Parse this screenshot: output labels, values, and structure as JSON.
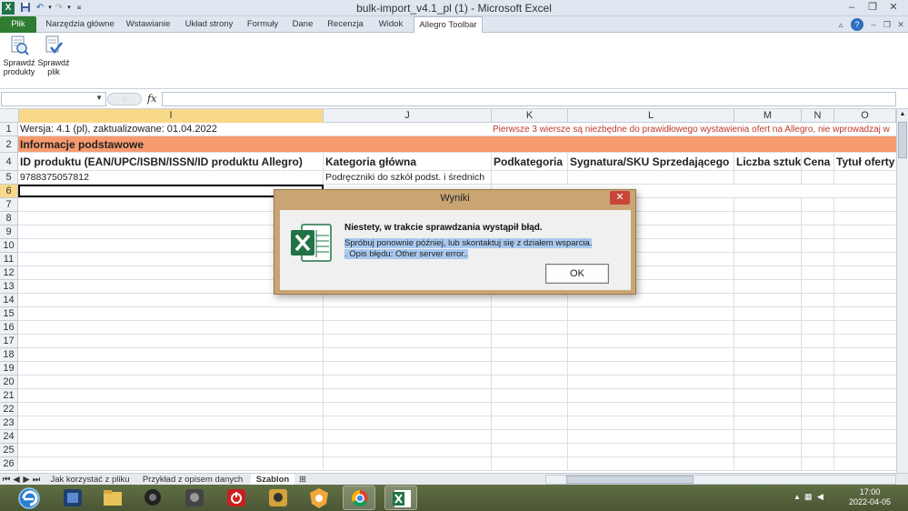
{
  "window": {
    "title": "bulk-import_v4.1_pl (1)  -  Microsoft Excel"
  },
  "ribbon_tabs": [
    {
      "label": "Plik"
    },
    {
      "label": "Narzędzia główne"
    },
    {
      "label": "Wstawianie"
    },
    {
      "label": "Układ strony"
    },
    {
      "label": "Formuły"
    },
    {
      "label": "Dane"
    },
    {
      "label": "Recenzja"
    },
    {
      "label": "Widok"
    },
    {
      "label": "Allegro Toolbar"
    }
  ],
  "ribbon": {
    "check_products_label": "Sprawdź produkty",
    "check_file_label": "Sprawdź plik"
  },
  "formula_bar": {
    "name_box_value": "",
    "fx_label": "fx",
    "formula_value": ""
  },
  "columns": [
    "I",
    "J",
    "K",
    "L",
    "M",
    "N",
    "O"
  ],
  "row_numbers": [
    "1",
    "2",
    "3",
    "4",
    "5",
    "6",
    "7",
    "8",
    "9",
    "10",
    "11",
    "12",
    "13",
    "14",
    "15",
    "16",
    "17",
    "18",
    "19",
    "20",
    "21",
    "22",
    "23",
    "24",
    "25",
    "26"
  ],
  "cells": {
    "r1_version": "Wersja: 4.1 (pl), zaktualizowane: 01.04.2022",
    "r1_note": "Pierwsze 3 wiersze są niezbędne do prawidłowego wystawienia ofert na Allegro, nie wprowadzaj w",
    "r2_section": "Informacje podstawowe",
    "r4_headers": [
      "ID produktu (EAN/UPC/ISBN/ISSN/ID produktu Allegro)",
      "Kategoria główna",
      "Podkategoria",
      "Sygnatura/SKU Sprzedającego",
      "Liczba sztuk",
      "Cena",
      "Tytuł oferty"
    ],
    "r5_values": [
      "9788375057812",
      "Podręczniki do szkół podst. i średnich"
    ]
  },
  "sheet_tabs": [
    {
      "label": "Jak korzystać z pliku"
    },
    {
      "label": "Przykład z opisem danych"
    },
    {
      "label": "Szablon"
    }
  ],
  "dialog": {
    "title": "Wyniki",
    "close_label": "✕",
    "main_message": "Niestety, w trakcie sprawdzania wystąpił błąd.",
    "detail_line1": "Spróbuj ponownie później, lub skontaktuj się z działem wsparcia.",
    "detail_line2": ". Opis błędu: Other server error..",
    "ok_label": "OK"
  },
  "taskbar": {
    "time": "17:00",
    "date": "2022-04-05",
    "apps": [
      "internet-explorer",
      "media-app",
      "file-explorer",
      "media-player",
      "tools-app",
      "power-app",
      "camera-app",
      "browser-app",
      "chrome",
      "excel"
    ]
  },
  "colors": {
    "section_header": "#f79a6e",
    "note_text": "#c0392b",
    "dialog_frame": "#c9a574",
    "excel_green": "#217346",
    "file_tab": "#2f7d32"
  }
}
